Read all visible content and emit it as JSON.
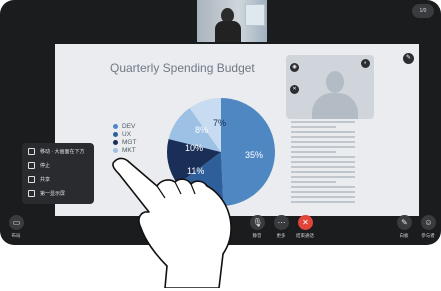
{
  "top_badge": "1/0",
  "slide": {
    "title": "Quarterly Spending Budget"
  },
  "chart_data": {
    "type": "pie",
    "title": "Quarterly Spending Budget",
    "categories": [
      "DEV",
      "UX",
      "MGT",
      "MKT"
    ],
    "values": [
      35,
      10,
      8,
      7
    ],
    "slice_labels": [
      "35%",
      "11%",
      "10%",
      "8%",
      "7%"
    ],
    "colors": [
      "#4f87c3",
      "#2f5f9a",
      "#1a2f57",
      "#9dc1e5",
      "#c7dcf0"
    ]
  },
  "menu": {
    "items": [
      {
        "label": "移动 · 大画面在下方"
      },
      {
        "label": "停止"
      },
      {
        "label": "共享"
      },
      {
        "label": "第一显示屏"
      }
    ]
  },
  "toolbar": {
    "left_label": "布局",
    "mute_label": "静音",
    "more_label": "更多",
    "end_label": "结束通话",
    "whiteboard_label": "白板",
    "participants_label": "参与者"
  }
}
